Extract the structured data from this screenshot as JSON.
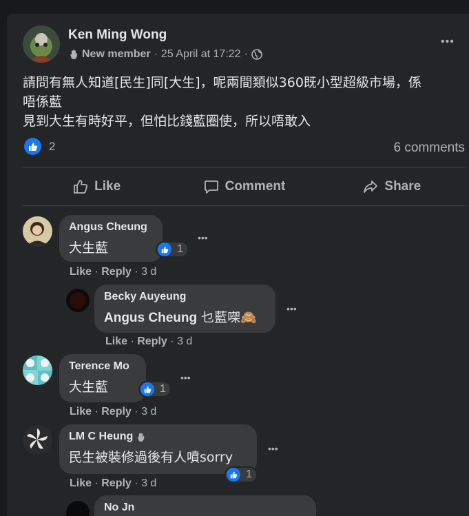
{
  "post": {
    "author": "Ken Ming Wong",
    "badge": "New member",
    "timestamp": "25 April at 17:22",
    "text_line1": "請問有無人知道[民生]同[大生]，呢兩間類似360既小型超級市場，係",
    "text_line2": "唔係藍",
    "text_line3": "見到大生有時好平，但怕比錢藍圈使，所以唔敢入",
    "reaction_count": "2",
    "comments_label": "6 comments",
    "more_label": "•••"
  },
  "actions": {
    "like": "Like",
    "comment": "Comment",
    "share": "Share"
  },
  "comments": [
    {
      "author": "Angus Cheung",
      "text": "大生藍",
      "reactions": "1",
      "like": "Like",
      "reply": "Reply",
      "time": "3 d"
    },
    {
      "author": "Becky Auyeung",
      "tag": "Angus Cheung",
      "text": " 乜藍㗎🙈",
      "like": "Like",
      "reply": "Reply",
      "time": "3 d"
    },
    {
      "author": "Terence Mo",
      "text": "大生藍",
      "reactions": "1",
      "like": "Like",
      "reply": "Reply",
      "time": "3 d"
    },
    {
      "author": "LM C Heung",
      "text": "民生被裝修過後有人噴sorry",
      "reactions": "1",
      "like": "Like",
      "reply": "Reply",
      "time": "3 d"
    },
    {
      "author": "No Jn"
    }
  ],
  "separators": {
    "dot": "·"
  },
  "colors": {
    "page_bg": "#18191a",
    "card_bg": "#242526",
    "bubble_bg": "#3a3b3c",
    "primary_text": "#e4e6eb",
    "secondary_text": "#b0b3b8",
    "like_blue": "#1877f2"
  },
  "icons": {
    "reaction": "thumbs-up-icon",
    "privacy": "globe-icon",
    "member": "waving-hand-icon"
  }
}
